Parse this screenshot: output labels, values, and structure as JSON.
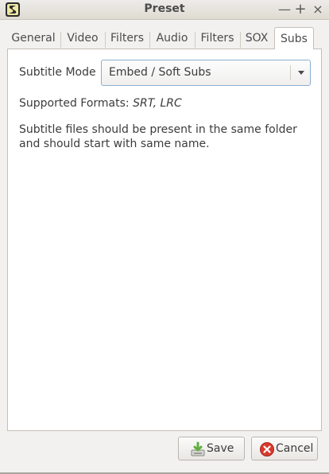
{
  "window": {
    "title": "Preset",
    "controls": {
      "minimize": "—",
      "maximize": "+",
      "close": "×"
    }
  },
  "tabs": [
    {
      "label": "General",
      "active": false
    },
    {
      "label": "Video",
      "active": false
    },
    {
      "label": "Filters",
      "active": false
    },
    {
      "label": "Audio",
      "active": false
    },
    {
      "label": "Filters",
      "active": false
    },
    {
      "label": "SOX",
      "active": false
    },
    {
      "label": "Subs",
      "active": true
    }
  ],
  "subs": {
    "mode_label": "Subtitle Mode",
    "mode_value": "Embed / Soft Subs",
    "formats_label": "Supported Formats:",
    "formats_list": "SRT, LRC",
    "help_line1": "Subtitle files should be present in the same folder",
    "help_line2": "and should start with same name."
  },
  "buttons": {
    "save": "Save",
    "cancel": "Cancel"
  },
  "colors": {
    "window_bg": "#f2f1f0",
    "panel_bg": "#ffffff",
    "focus_border": "#8aaed1",
    "cancel_icon": "#d93a2e",
    "save_icon": "#5fae3f"
  }
}
